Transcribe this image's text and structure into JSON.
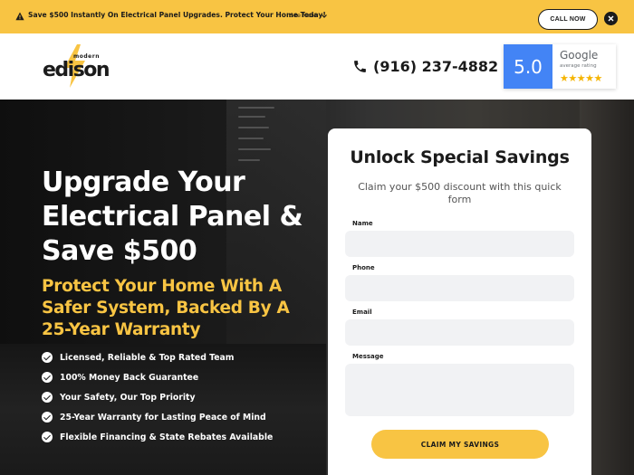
{
  "banner": {
    "message": "Save $500 Instantly On Electrical Panel Upgrades. Protect Your Home Today!",
    "see_more": "See More",
    "call_now": "CALL NOW"
  },
  "header": {
    "logo_word": "edison",
    "logo_tag": "modern",
    "phone": "(916) 237-4882",
    "google": {
      "score": "5.0",
      "brand": "Google",
      "subtitle": "average rating",
      "stars": "★★★★★"
    }
  },
  "hero": {
    "headline": "Upgrade Your Electrical Panel & Save $500",
    "subheadline": "Protect Your Home With A Safer System, Backed By A 25-Year Warranty",
    "features": [
      "Licensed, Reliable & Top Rated Team",
      "100% Money Back Guarantee",
      "Your Safety, Our Top Priority",
      "25-Year Warranty for Lasting Peace of Mind",
      "Flexible Financing & State Rebates Available"
    ]
  },
  "form": {
    "title": "Unlock Special Savings",
    "subtitle": "Claim your $500 discount with this quick form",
    "fields": {
      "name_label": "Name",
      "phone_label": "Phone",
      "email_label": "Email",
      "message_label": "Message"
    },
    "submit": "CLAIM MY SAVINGS"
  },
  "colors": {
    "accent": "#f8c443",
    "google_blue": "#4384f5",
    "dark": "#1b1b1b"
  }
}
